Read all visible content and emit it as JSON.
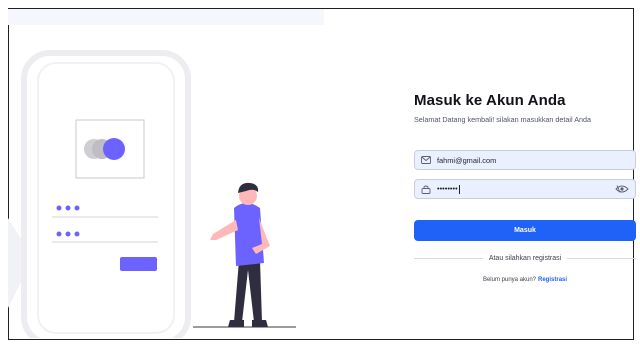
{
  "login": {
    "title": "Masuk ke Akun Anda",
    "subtitle": "Selamat Datang kembali! silakan masukkan detail Anda",
    "email_value": "fahmi@gmail.com",
    "password_value": "••••••••",
    "submit_label": "Masuk",
    "divider_text": "Atau silahkan registrasi",
    "register_prompt": "Belum punya akun?",
    "register_link": "Registrasi"
  },
  "colors": {
    "accent": "#1e62f7",
    "illustration_purple": "#6c63ff",
    "input_bg": "#eaf0ff"
  },
  "icons": {
    "email": "mail-icon",
    "password": "lock-icon",
    "toggle": "eye-icon"
  }
}
